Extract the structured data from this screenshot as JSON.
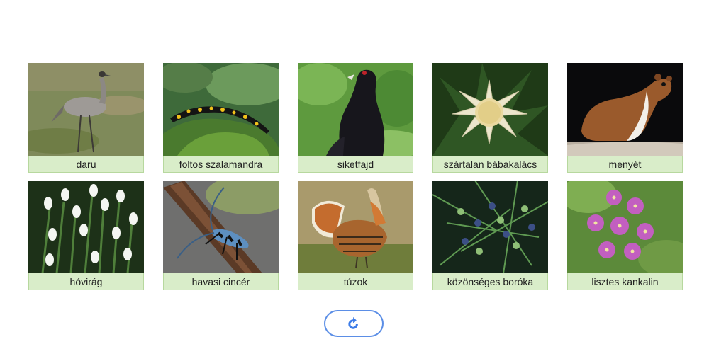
{
  "cards": [
    {
      "label": "daru",
      "icon": "crane-photo"
    },
    {
      "label": "foltos szalamandra",
      "icon": "fire-salamander-photo"
    },
    {
      "label": "siketfajd",
      "icon": "capercaillie-photo"
    },
    {
      "label": "szártalan bábakalács",
      "icon": "carline-thistle-photo"
    },
    {
      "label": "menyét",
      "icon": "weasel-photo"
    },
    {
      "label": "hóvirág",
      "icon": "snowdrop-photo"
    },
    {
      "label": "havasi cincér",
      "icon": "rosalia-longicorn-photo"
    },
    {
      "label": "túzok",
      "icon": "great-bustard-photo"
    },
    {
      "label": "közönséges boróka",
      "icon": "juniper-photo"
    },
    {
      "label": "lisztes kankalin",
      "icon": "bird-eye-primrose-photo"
    }
  ],
  "reload": {
    "icon": "reload-icon"
  },
  "colors": {
    "label_bg": "#d9edc9",
    "label_border": "#b7d89e",
    "button_border": "#5b8ee6",
    "icon_blue": "#3d7ce8"
  }
}
